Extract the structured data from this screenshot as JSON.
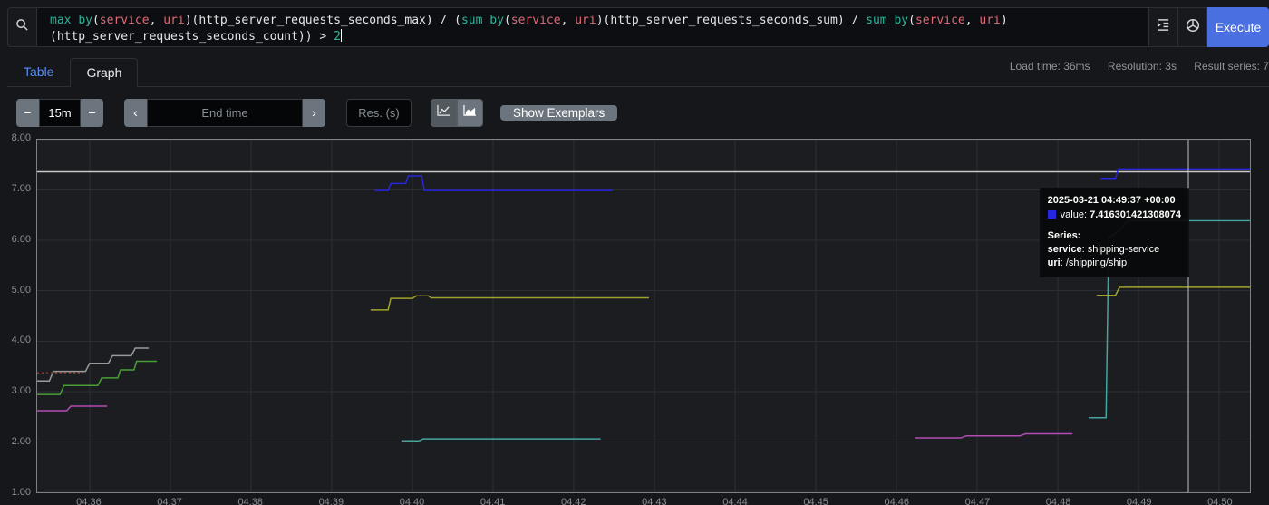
{
  "colors": {
    "accent": "#4a6fe0",
    "link": "#5b8def"
  },
  "query_bar": {
    "tokens": [
      [
        "max",
        "kw"
      ],
      [
        " ",
        "pl"
      ],
      [
        "by",
        "kw"
      ],
      [
        "(",
        "pl"
      ],
      [
        "service",
        "lb"
      ],
      [
        ", ",
        "pl"
      ],
      [
        "uri",
        "lb"
      ],
      [
        ")(http_server_requests_seconds_max) / (",
        "pl"
      ],
      [
        "sum",
        "kw"
      ],
      [
        " ",
        "pl"
      ],
      [
        "by",
        "kw"
      ],
      [
        "(",
        "pl"
      ],
      [
        "service",
        "lb"
      ],
      [
        ", ",
        "pl"
      ],
      [
        "uri",
        "lb"
      ],
      [
        ")(http_server_requests_seconds_sum) / ",
        "pl"
      ],
      [
        "sum",
        "kw"
      ],
      [
        " ",
        "pl"
      ],
      [
        "by",
        "kw"
      ],
      [
        "(",
        "pl"
      ],
      [
        "service",
        "lb"
      ],
      [
        ", ",
        "pl"
      ],
      [
        "uri",
        "lb"
      ],
      [
        ")",
        "pl"
      ],
      [
        "\n",
        "pl"
      ],
      [
        "(http_server_requests_seconds_count)) > ",
        "pl"
      ],
      [
        "2",
        "nm"
      ]
    ],
    "icons": {
      "search": "magnifier",
      "format": "indent-lines",
      "explorer": "globe",
      "chart_line": "line-chart",
      "chart_stacked": "stacked-chart"
    },
    "execute_label": "Execute"
  },
  "tabs": {
    "table": "Table",
    "graph": "Graph"
  },
  "stats": {
    "load_time": "Load time: 36ms",
    "resolution": "Resolution: 3s",
    "result_series": "Result series: 7"
  },
  "toolbar": {
    "minus": "−",
    "plus": "+",
    "duration": "15m",
    "prev": "‹",
    "next": "›",
    "end_time_placeholder": "End time",
    "res_placeholder": "Res. (s)",
    "show_exemplars": "Show Exemplars"
  },
  "tooltip": {
    "timestamp": "2025-03-21 04:49:37 +00:00",
    "value_label": "value:",
    "value": "7.416301421308074",
    "series_heading": "Series:",
    "labels": [
      {
        "name": "service",
        "value": "shipping-service"
      },
      {
        "name": "uri",
        "value": "/shipping/ship"
      }
    ],
    "swatch_color": "#2526e0"
  },
  "chart_data": {
    "type": "line",
    "title": "",
    "xlabel": "",
    "ylabel": "",
    "grid": true,
    "x_axis": {
      "start": "04:35:21",
      "end": "04:50:23",
      "ticks": [
        "04:36",
        "04:37",
        "04:38",
        "04:39",
        "04:40",
        "04:41",
        "04:42",
        "04:43",
        "04:44",
        "04:45",
        "04:46",
        "04:47",
        "04:48",
        "04:49",
        "04:50"
      ]
    },
    "y_axis": {
      "min": 1,
      "max": 8,
      "ticks": [
        "8.00",
        "7.00",
        "6.00",
        "5.00",
        "4.00",
        "3.00",
        "2.00",
        "1.00"
      ]
    },
    "crosshair_time": "04:49:37",
    "series": [
      {
        "name": "light-gray-flat",
        "color": "#c8c8c8",
        "dash": false,
        "segments": [
          [
            [
              "04:35:21",
              7.36
            ],
            [
              "04:50:23",
              7.36
            ]
          ]
        ]
      },
      {
        "name": "gray-steps",
        "color": "#9a9a9a",
        "dash": false,
        "segments": [
          [
            [
              "04:35:21",
              3.21
            ],
            [
              "04:35:30",
              3.21
            ],
            [
              "04:35:33",
              3.4
            ],
            [
              "04:35:57",
              3.4
            ],
            [
              "04:36:00",
              3.56
            ],
            [
              "04:36:14",
              3.56
            ],
            [
              "04:36:17",
              3.71
            ],
            [
              "04:36:31",
              3.71
            ],
            [
              "04:36:34",
              3.86
            ],
            [
              "04:36:44",
              3.86
            ]
          ]
        ]
      },
      {
        "name": "dark-red-dashed",
        "color": "#943526",
        "dash": true,
        "segments": [
          [
            [
              "04:35:21",
              3.37
            ],
            [
              "04:35:55",
              3.37
            ]
          ]
        ]
      },
      {
        "name": "green",
        "color": "#4a9e35",
        "dash": false,
        "segments": [
          [
            [
              "04:35:21",
              2.94
            ],
            [
              "04:35:38",
              2.94
            ],
            [
              "04:35:41",
              3.12
            ],
            [
              "04:36:06",
              3.12
            ],
            [
              "04:36:09",
              3.27
            ],
            [
              "04:36:21",
              3.27
            ],
            [
              "04:36:23",
              3.43
            ],
            [
              "04:36:33",
              3.43
            ],
            [
              "04:36:35",
              3.6
            ],
            [
              "04:36:50",
              3.6
            ]
          ]
        ]
      },
      {
        "name": "magenta",
        "color": "#b34cb3",
        "dash": false,
        "segments": [
          [
            [
              "04:35:21",
              2.62
            ],
            [
              "04:35:43",
              2.62
            ],
            [
              "04:35:46",
              2.71
            ],
            [
              "04:36:13",
              2.71
            ]
          ],
          [
            [
              "04:46:14",
              2.08
            ],
            [
              "04:46:48",
              2.08
            ],
            [
              "04:46:52",
              2.12
            ],
            [
              "04:47:32",
              2.12
            ],
            [
              "04:47:36",
              2.16
            ],
            [
              "04:48:11",
              2.16
            ]
          ]
        ]
      },
      {
        "name": "teal",
        "color": "#46a5a0",
        "dash": false,
        "segments": [
          [
            [
              "04:39:52",
              2.02
            ],
            [
              "04:40:05",
              2.02
            ],
            [
              "04:40:08",
              2.06
            ],
            [
              "04:42:20",
              2.06
            ]
          ],
          [
            [
              "04:48:23",
              2.48
            ],
            [
              "04:48:36",
              2.48
            ],
            [
              "04:48:38",
              6.05
            ],
            [
              "04:48:46",
              6.2
            ],
            [
              "04:48:52",
              6.39
            ],
            [
              "04:50:23",
              6.39
            ]
          ]
        ]
      },
      {
        "name": "olive",
        "color": "#a0a32b",
        "dash": false,
        "segments": [
          [
            [
              "04:39:29",
              4.62
            ],
            [
              "04:39:42",
              4.62
            ],
            [
              "04:39:44",
              4.85
            ],
            [
              "04:40:00",
              4.85
            ],
            [
              "04:40:03",
              4.9
            ],
            [
              "04:40:12",
              4.9
            ],
            [
              "04:40:14",
              4.86
            ],
            [
              "04:42:56",
              4.86
            ]
          ],
          [
            [
              "04:48:29",
              4.91
            ],
            [
              "04:48:43",
              4.91
            ],
            [
              "04:48:46",
              5.07
            ],
            [
              "04:50:23",
              5.07
            ]
          ]
        ]
      },
      {
        "name": "shipping-service /shipping/ship",
        "color": "#2526e0",
        "dash": false,
        "segments": [
          [
            [
              "04:39:32",
              6.99
            ],
            [
              "04:39:42",
              6.99
            ],
            [
              "04:39:44",
              7.13
            ],
            [
              "04:39:55",
              7.13
            ],
            [
              "04:39:57",
              7.28
            ],
            [
              "04:40:07",
              7.28
            ],
            [
              "04:40:09",
              6.99
            ],
            [
              "04:42:29",
              6.99
            ]
          ],
          [
            [
              "04:48:32",
              7.23
            ],
            [
              "04:48:43",
              7.23
            ],
            [
              "04:48:45",
              7.4163
            ],
            [
              "04:50:23",
              7.4163
            ]
          ]
        ]
      }
    ]
  }
}
